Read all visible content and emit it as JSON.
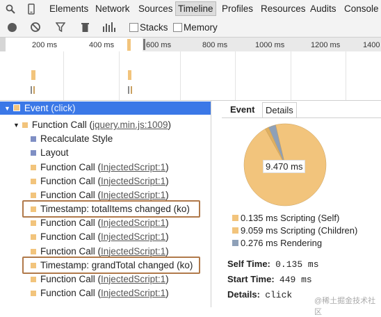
{
  "tabs": [
    "Elements",
    "Network",
    "Sources",
    "Timeline",
    "Profiles",
    "Resources",
    "Audits",
    "Console"
  ],
  "active_tab": "Timeline",
  "toolbar": {
    "stacks_label": "Stacks",
    "memory_label": "Memory"
  },
  "ruler": {
    "left_ticks": [
      "200 ms",
      "400 ms"
    ],
    "right_ticks": [
      "600 ms",
      "800 ms",
      "1000 ms",
      "1200 ms",
      "1400 ms"
    ]
  },
  "colors": {
    "scripting": "#f2c47c",
    "rendering": "#8a9fcf",
    "selected": "#3b78e7",
    "highlight": "#b0794a",
    "rendering_pie": "#8ea0b8"
  },
  "tree": {
    "rows": [
      {
        "label": "Event",
        "suffix": "(click)",
        "link": "",
        "kind": "event",
        "selected": true
      },
      {
        "label": "Function Call",
        "suffix": "",
        "link": "jquery.min.js:1009",
        "kind": "scripting"
      },
      {
        "label": "Recalculate Style",
        "suffix": "",
        "link": "",
        "kind": "rendering"
      },
      {
        "label": "Layout",
        "suffix": "",
        "link": "",
        "kind": "rendering"
      },
      {
        "label": "Function Call",
        "suffix": "",
        "link": "InjectedScript:1",
        "kind": "scripting"
      },
      {
        "label": "Function Call",
        "suffix": "",
        "link": "InjectedScript:1",
        "kind": "scripting"
      },
      {
        "label": "Function Call",
        "suffix": "",
        "link": "InjectedScript:1",
        "kind": "scripting"
      },
      {
        "label": "Timestamp: totalItems changed (ko)",
        "suffix": "",
        "link": "",
        "kind": "scripting",
        "boxed": true
      },
      {
        "label": "Function Call",
        "suffix": "",
        "link": "InjectedScript:1",
        "kind": "scripting"
      },
      {
        "label": "Function Call",
        "suffix": "",
        "link": "InjectedScript:1",
        "kind": "scripting"
      },
      {
        "label": "Function Call",
        "suffix": "",
        "link": "InjectedScript:1",
        "kind": "scripting"
      },
      {
        "label": "Timestamp: grandTotal changed (ko)",
        "suffix": "",
        "link": "",
        "kind": "scripting",
        "boxed": true
      },
      {
        "label": "Function Call",
        "suffix": "",
        "link": "InjectedScript:1",
        "kind": "scripting"
      },
      {
        "label": "Function Call",
        "suffix": "",
        "link": "InjectedScript:1",
        "kind": "scripting"
      }
    ]
  },
  "detail": {
    "tabs": [
      "Event",
      "Details"
    ],
    "pie_label": "9.470 ms",
    "pie": {
      "scripting_self": 0.135,
      "scripting_children": 9.059,
      "rendering": 0.276
    },
    "legend": [
      {
        "text": "0.135 ms Scripting (Self)",
        "color": "#f2c47c"
      },
      {
        "text": "9.059 ms Scripting (Children)",
        "color": "#f2c47c"
      },
      {
        "text": "0.276 ms Rendering",
        "color": "#8ea0b8"
      }
    ],
    "self_time_label": "Self Time:",
    "self_time": "0.135 ms",
    "start_time_label": "Start Time:",
    "start_time": "449 ms",
    "details_label": "Details:",
    "details": "click"
  },
  "watermark": "@稀土掘金技术社区"
}
